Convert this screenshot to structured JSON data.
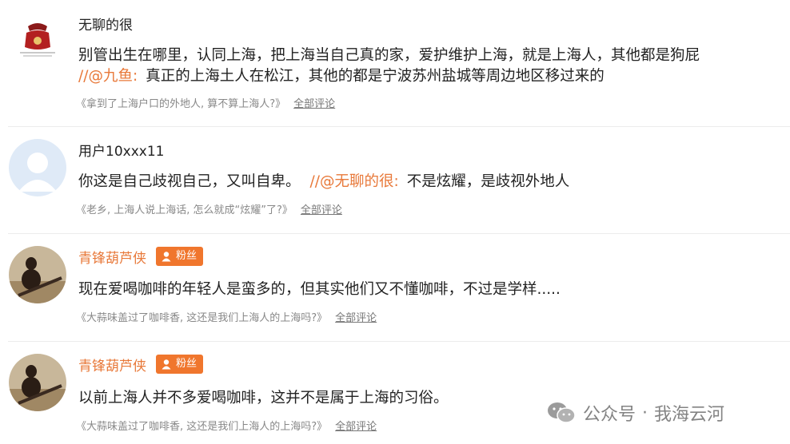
{
  "comments": [
    {
      "username": "无聊的很",
      "line1": "别管出生在哪里，认同上海，把上海当自己真的家，爱护维护上海，就是上海人，其他都是狗屁",
      "reply_at": "//@九鱼:",
      "reply_text": "真正的上海土人在松江，其他的都是宁波苏州盐城等周边地区移过来的",
      "source": "《拿到了上海户口的外地人, 算不算上海人?》",
      "all_link": "全部评论"
    },
    {
      "username": "用户10xxx11",
      "text": "你这是自己歧视自己，又叫自卑。",
      "reply_at": "//@无聊的很:",
      "reply_text": "不是炫耀，是歧视外地人",
      "source": "《老乡, 上海人说上海话, 怎么就成“炫耀”了?》",
      "all_link": "全部评论"
    },
    {
      "username": "青锋葫芦侠",
      "badge": "粉丝",
      "text": "现在爱喝咖啡的年轻人是蛮多的，但其实他们又不懂咖啡，不过是学样.....",
      "source": "《大蒜味盖过了咖啡香, 这还是我们上海人的上海吗?》",
      "all_link": "全部评论"
    },
    {
      "username": "青锋葫芦侠",
      "badge": "粉丝",
      "text": "以前上海人并不多爱喝咖啡，这并不是属于上海的习俗。",
      "source": "《大蒜味盖过了咖啡香, 这还是我们上海人的上海吗?》",
      "all_link": "全部评论"
    }
  ],
  "watermark": {
    "prefix": "公众号",
    "dot": "·",
    "name": "我海云河"
  },
  "colors": {
    "accent": "#e8793a",
    "badge": "#f0762d",
    "muted": "#888888"
  }
}
